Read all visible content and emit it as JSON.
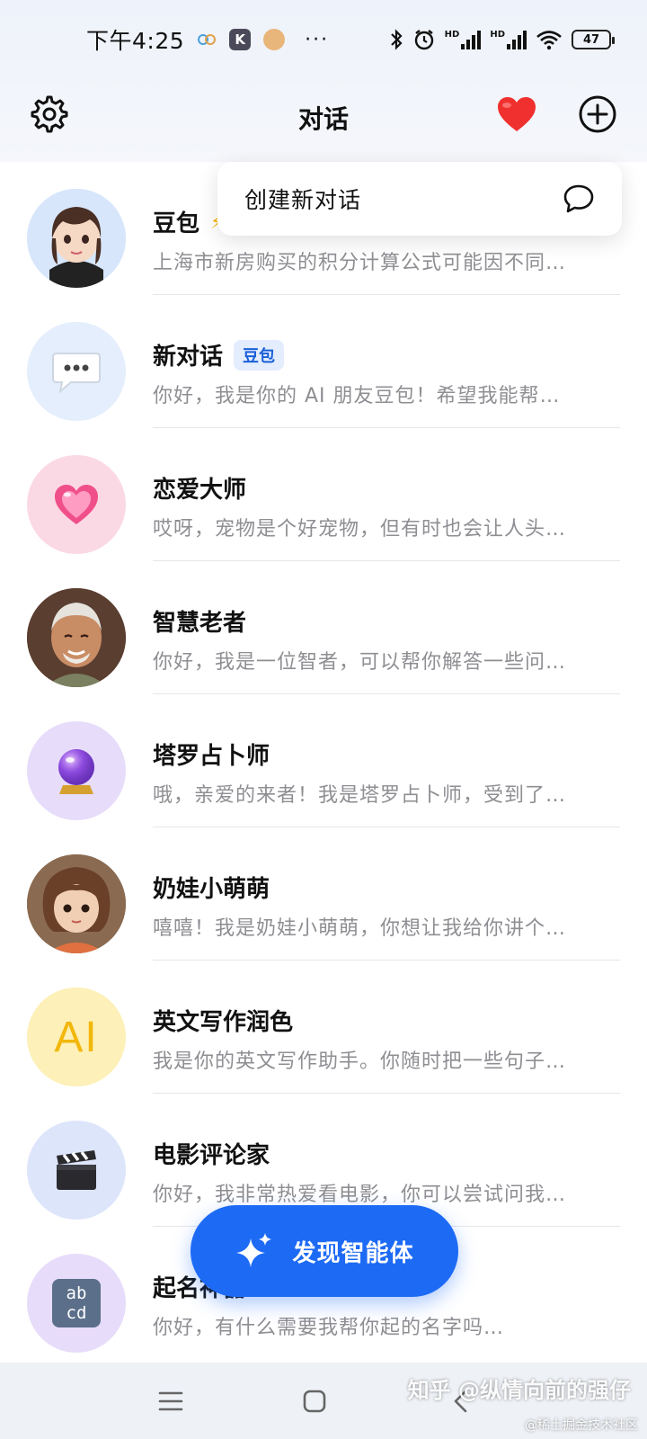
{
  "status_bar": {
    "time": "下午4:25",
    "battery": "47",
    "hd1": "HD",
    "hd2": "HD",
    "more": "···"
  },
  "header": {
    "title": "对话",
    "icons": {
      "settings": "gear-icon",
      "favorite": "heart-icon",
      "add": "plus-circle-icon"
    },
    "accent_heart": "#f0302e"
  },
  "popover": {
    "label": "创建新对话",
    "icon": "chat-bubble-icon"
  },
  "chats": [
    {
      "name": "豆包",
      "badge": "⚡",
      "preview": "上海市新房购买的积分计算公式可能因不同…",
      "avatar_icon": "girl-avatar",
      "avatar_bg": "#d7e6fb"
    },
    {
      "name": "新对话",
      "tag": "豆包",
      "preview": "你好，我是你的 AI 朋友豆包！希望我能帮…",
      "avatar_icon": "speech-bubble-icon",
      "avatar_bg": "#e4eefc"
    },
    {
      "name": "恋爱大师",
      "preview": "哎呀，宠物是个好宠物，但有时也会让人头…",
      "avatar_icon": "heart-gift-icon",
      "avatar_bg": "#fbd9e4"
    },
    {
      "name": "智慧老者",
      "preview": "你好，我是一位智者，可以帮你解答一些问…",
      "avatar_icon": "elder-avatar",
      "avatar_bg": "#6b4a3a"
    },
    {
      "name": "塔罗占卜师",
      "preview": "哦，亲爱的来者！我是塔罗占卜师，受到了…",
      "avatar_icon": "crystal-ball-icon",
      "avatar_bg": "#e7dcfa"
    },
    {
      "name": "奶娃小萌萌",
      "preview": "嘻嘻！我是奶娃小萌萌，你想让我给你讲个…",
      "avatar_icon": "child-avatar",
      "avatar_bg": "#8a6a50"
    },
    {
      "name": "英文写作润色",
      "preview": "我是你的英文写作助手。你随时把一些句子…",
      "avatar_icon": "ai-text-icon",
      "avatar_text": "AI",
      "avatar_bg": "#fdf0b8"
    },
    {
      "name": "电影评论家",
      "preview": "你好，我非常热爱看电影，你可以尝试问我…",
      "avatar_icon": "clapperboard-icon",
      "avatar_bg": "#dde5fb"
    },
    {
      "name": "起名神器",
      "preview": "你好，有什么需要我帮你起的名字吗…",
      "avatar_icon": "abcd-icon",
      "avatar_text1": "ab",
      "avatar_text2": "cd",
      "avatar_bg": "#e7dcfa"
    }
  ],
  "fab": {
    "label": "发现智能体",
    "icon": "sparkle-icon",
    "color": "#1d6af5"
  },
  "nav": {
    "menu": "menu-icon",
    "home": "square-icon",
    "back": "back-icon"
  },
  "watermark": {
    "main": "知乎 @纵情向前的强仔",
    "sub": "@稀土掘金技术社区"
  }
}
